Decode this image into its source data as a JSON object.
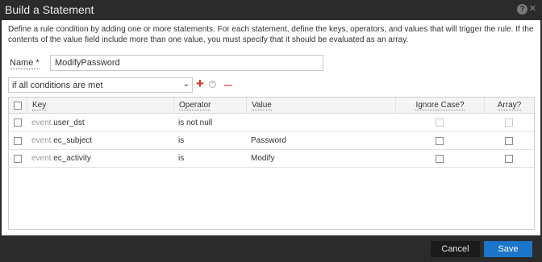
{
  "dialog": {
    "title": "Build a Statement",
    "help_icon": "?",
    "close_icon": "×"
  },
  "description": "Define a rule condition by adding one or more statements. For each statement, define the keys, operators, and values that will trigger the rule. If the contents of the value field include more than one value, you must specify that it should be evaluated as an array.",
  "name_field": {
    "label": "Name *",
    "value": "ModifyPassword"
  },
  "condition": {
    "selected": "if all conditions are met",
    "chevron": "⌄",
    "add_icon": "+",
    "add_group_icon": "+"
  },
  "grid": {
    "columns": {
      "key": "Key",
      "operator": "Operator",
      "value": "Value",
      "ignore_case": "Ignore Case?",
      "array": "Array?"
    },
    "rows": [
      {
        "key_prefix": "event.",
        "key_field": "user_dst",
        "operator": "is not null",
        "value": ""
      },
      {
        "key_prefix": "event.",
        "key_field": "ec_subject",
        "operator": "is",
        "value": "Password"
      },
      {
        "key_prefix": "event.",
        "key_field": "ec_activity",
        "operator": "is",
        "value": "Modify"
      }
    ]
  },
  "footer": {
    "cancel_label": "Cancel",
    "save_label": "Save"
  },
  "colors": {
    "titlebar": "#2b2b2b",
    "save_button": "#1b75c9",
    "add_icon": "#d52b1e",
    "remove_icon": "#e88a8a"
  }
}
